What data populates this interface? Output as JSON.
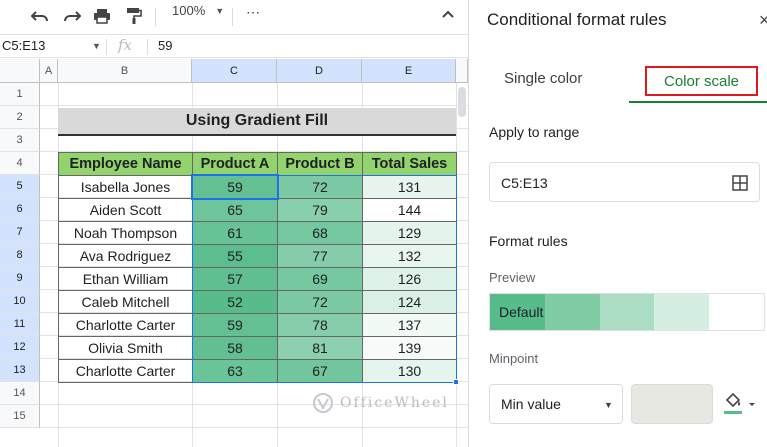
{
  "toolbar": {
    "zoom": "100%",
    "more": "⋯",
    "icons": [
      "undo-icon",
      "redo-icon",
      "print-icon",
      "paint-format-icon",
      "collapse-icon"
    ]
  },
  "formula_bar": {
    "name_box": "C5:E13",
    "fx": "fx",
    "value": "59"
  },
  "sheet": {
    "columns": [
      "A",
      "B",
      "C",
      "D",
      "E"
    ],
    "rows": [
      "1",
      "2",
      "3",
      "4",
      "5",
      "6",
      "7",
      "8",
      "9",
      "10",
      "11",
      "12",
      "13",
      "14",
      "15"
    ],
    "title": "Using Gradient Fill",
    "headers": [
      "Employee Name",
      "Product A",
      "Product B",
      "Total Sales"
    ],
    "data": [
      [
        "Isabella Jones",
        "59",
        "72",
        "131"
      ],
      [
        "Aiden Scott",
        "65",
        "79",
        "144"
      ],
      [
        "Noah Thompson",
        "61",
        "68",
        "129"
      ],
      [
        "Ava Rodriguez",
        "55",
        "77",
        "132"
      ],
      [
        "Ethan William",
        "57",
        "69",
        "126"
      ],
      [
        "Caleb Mitchell",
        "52",
        "72",
        "124"
      ],
      [
        "Charlotte Carter",
        "59",
        "78",
        "137"
      ],
      [
        "Olivia Smith",
        "58",
        "81",
        "139"
      ],
      [
        "Charlotte Carter",
        "63",
        "67",
        "130"
      ]
    ],
    "gradient": {
      "min_color": "#57bb8a",
      "max_color": "#ffffff",
      "min_value": 52,
      "max_value": 144
    },
    "header_color": "#92d36e"
  },
  "watermark": "OfficeWheel",
  "panel": {
    "title": "Conditional format rules",
    "close": "×",
    "tab_single": "Single color",
    "tab_scale": "Color scale",
    "apply_label": "Apply to range",
    "range": "C5:E13",
    "format_rules_label": "Format rules",
    "preview_label": "Preview",
    "preview_text": "Default",
    "preview_colors": [
      "#57bb8a",
      "#7fcba4",
      "#abddc4",
      "#d5eee2",
      "#ffffff"
    ],
    "minpoint_label": "Minpoint",
    "minpoint_value": "Min value",
    "accent": "#188038"
  }
}
